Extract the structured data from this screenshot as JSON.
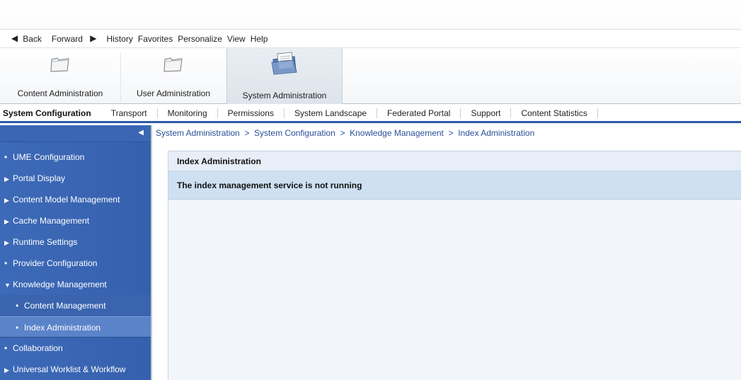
{
  "menubar": {
    "back": "Back",
    "forward": "Forward",
    "history": "History",
    "favorites": "Favorites",
    "personalize": "Personalize",
    "view": "View",
    "help": "Help"
  },
  "top_tabs": [
    {
      "label": "Content Administration",
      "icon": "folder-icon"
    },
    {
      "label": "User Administration",
      "icon": "folder-icon"
    },
    {
      "label": "System Administration",
      "icon": "documents-folder-icon",
      "active": true
    }
  ],
  "sub_tabs": [
    {
      "label": "System Configuration",
      "active": true
    },
    {
      "label": "Transport"
    },
    {
      "label": "Monitoring"
    },
    {
      "label": "Permissions"
    },
    {
      "label": "System Landscape"
    },
    {
      "label": "Federated Portal"
    },
    {
      "label": "Support"
    },
    {
      "label": "Content Statistics"
    }
  ],
  "nav": {
    "items": [
      {
        "label": "UME Configuration",
        "marker": "bullet"
      },
      {
        "label": "Portal Display",
        "marker": "expand-arrow"
      },
      {
        "label": "Content Model Management",
        "marker": "expand-arrow"
      },
      {
        "label": "Cache Management",
        "marker": "expand-arrow"
      },
      {
        "label": "Runtime Settings",
        "marker": "expand-arrow"
      },
      {
        "label": "Provider Configuration",
        "marker": "bullet"
      },
      {
        "label": "Knowledge Management",
        "marker": "collapse-arrow"
      },
      {
        "label": "Content Management",
        "marker": "bullet",
        "level": 2
      },
      {
        "label": "Index Administration",
        "marker": "bullet",
        "level": 2,
        "selected": true
      },
      {
        "label": "Collaboration",
        "marker": "bullet"
      },
      {
        "label": "Universal Worklist & Workflow",
        "marker": "expand-arrow"
      }
    ]
  },
  "breadcrumb": "System Administration  >  System Configuration  >  Knowledge Management  >  Index Administration",
  "content": {
    "title": "Index Administration",
    "message": "The index management service is not running"
  },
  "colors": {
    "nav_bg": "#3d6ab8",
    "nav_selected": "#5a83c9",
    "message_bg": "#cfe0f2",
    "accent": "#2c5aa8"
  }
}
